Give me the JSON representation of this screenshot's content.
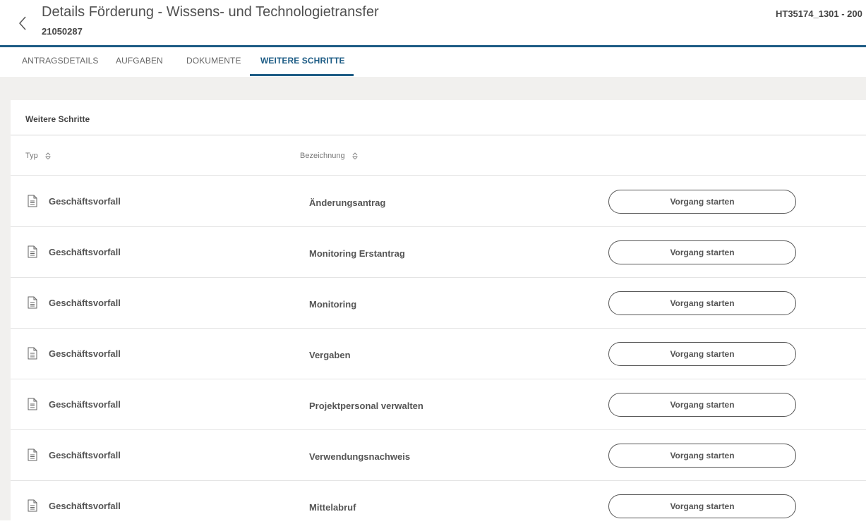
{
  "header": {
    "title": "Details Förderung - Wissens- und Technologietransfer",
    "subtitle": "21050287",
    "reference": "HT35174_1301 - 200"
  },
  "tabs": [
    {
      "label": "ANTRAGSDETAILS",
      "active": false
    },
    {
      "label": "AUFGABEN",
      "active": false
    },
    {
      "label": "DOKUMENTE",
      "active": false
    },
    {
      "label": "WEITERE SCHRITTE",
      "active": true
    }
  ],
  "card": {
    "title": "Weitere Schritte",
    "columns": {
      "type": "Typ",
      "name": "Bezeichnung"
    }
  },
  "rows": [
    {
      "type": "Geschäftsvorfall",
      "name": "Änderungsantrag",
      "action": "Vorgang starten"
    },
    {
      "type": "Geschäftsvorfall",
      "name": "Monitoring Erstantrag",
      "action": "Vorgang starten"
    },
    {
      "type": "Geschäftsvorfall",
      "name": "Monitoring",
      "action": "Vorgang starten"
    },
    {
      "type": "Geschäftsvorfall",
      "name": "Vergaben",
      "action": "Vorgang starten"
    },
    {
      "type": "Geschäftsvorfall",
      "name": "Projektpersonal verwalten",
      "action": "Vorgang starten"
    },
    {
      "type": "Geschäftsvorfall",
      "name": "Verwendungsnachweis",
      "action": "Vorgang starten"
    },
    {
      "type": "Geschäftsvorfall",
      "name": "Mittelabruf",
      "action": "Vorgang starten"
    }
  ],
  "icons": {
    "back": "chevron-left-icon",
    "sort": "sort-icon",
    "document": "document-icon"
  },
  "colors": {
    "accent": "#1d5c85",
    "background": "#f1f0ee",
    "text": "#505050"
  }
}
